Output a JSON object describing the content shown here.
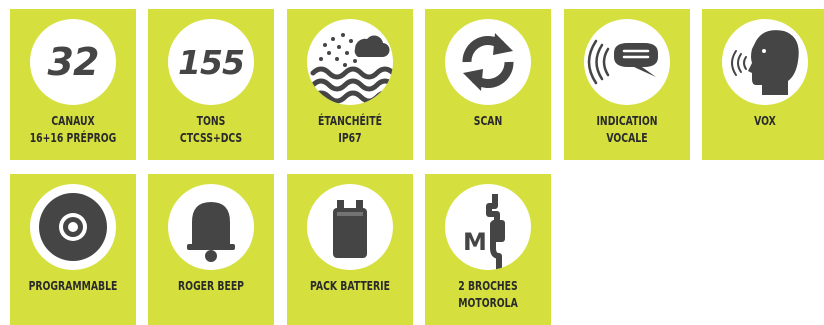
{
  "colors": {
    "tile": "#d5e03f",
    "icon": "#454545",
    "circle": "#ffffff"
  },
  "features": [
    {
      "id": "canaux",
      "icon": "number-32",
      "number": "32",
      "lines": [
        "CANAUX",
        "16+16 PRÉPROG"
      ]
    },
    {
      "id": "tons",
      "icon": "number-155",
      "number": "155",
      "lines": [
        "TONS",
        "CTCSS+DCS"
      ]
    },
    {
      "id": "etancheite",
      "icon": "waterproof-icon",
      "lines": [
        "ÉTANCHÉITÉ",
        "IP67"
      ]
    },
    {
      "id": "scan",
      "icon": "scan-arrows-icon",
      "lines": [
        "SCAN"
      ]
    },
    {
      "id": "indication-vocale",
      "icon": "voice-indication-icon",
      "lines": [
        "INDICATION",
        "VOCALE"
      ]
    },
    {
      "id": "vox",
      "icon": "vox-head-icon",
      "lines": [
        "VOX"
      ]
    },
    {
      "id": "programmable",
      "icon": "disc-icon",
      "lines": [
        "PROGRAMMABLE"
      ]
    },
    {
      "id": "roger-beep",
      "icon": "bell-icon",
      "lines": [
        "ROGER BEEP"
      ]
    },
    {
      "id": "pack-batterie",
      "icon": "battery-icon",
      "lines": [
        "PACK BATTERIE"
      ]
    },
    {
      "id": "broches-motorola",
      "icon": "motorola-plug-icon",
      "letter": "M",
      "lines": [
        "2 BROCHES",
        "MOTOROLA"
      ]
    }
  ]
}
